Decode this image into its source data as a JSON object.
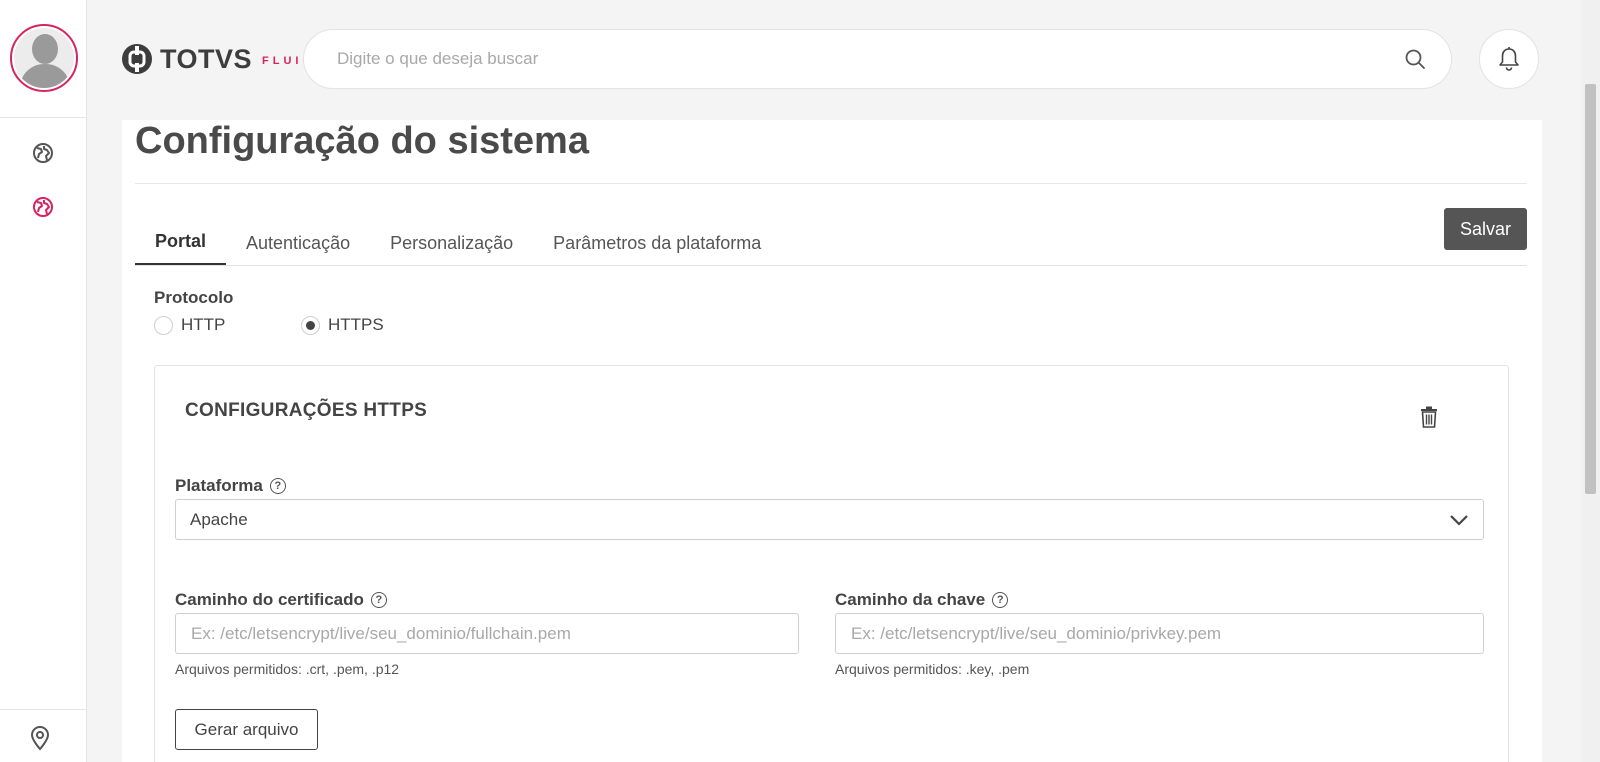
{
  "header": {
    "logo_text": "TOTVS",
    "logo_sub": "FLUIG",
    "search_placeholder": "Digite o que deseja buscar"
  },
  "sidebar": {
    "items": [
      {
        "icon": "globe-icon",
        "active": false
      },
      {
        "icon": "globe-icon",
        "active": true
      }
    ],
    "bottom_icon": "location-pin-icon"
  },
  "page": {
    "title": "Configuração do sistema",
    "tabs": [
      {
        "label": "Portal",
        "active": true
      },
      {
        "label": "Autenticação",
        "active": false
      },
      {
        "label": "Personalização",
        "active": false
      },
      {
        "label": "Parâmetros da plataforma",
        "active": false
      }
    ],
    "save_label": "Salvar"
  },
  "protocol": {
    "label": "Protocolo",
    "options": [
      {
        "label": "HTTP",
        "checked": false
      },
      {
        "label": "HTTPS",
        "checked": true
      }
    ]
  },
  "https_config": {
    "title": "CONFIGURAÇÕES HTTPS",
    "platform_label": "Plataforma",
    "platform_value": "Apache",
    "cert_label": "Caminho do certificado",
    "cert_placeholder": "Ex: /etc/letsencrypt/live/seu_dominio/fullchain.pem",
    "cert_hint": "Arquivos permitidos: .crt, .pem, .p12",
    "key_label": "Caminho da chave",
    "key_placeholder": "Ex: /etc/letsencrypt/live/seu_dominio/privkey.pem",
    "key_hint": "Arquivos permitidos: .key, .pem",
    "generate_label": "Gerar arquivo"
  },
  "colors": {
    "accent": "#d8235e",
    "primary_button": "#555555"
  }
}
